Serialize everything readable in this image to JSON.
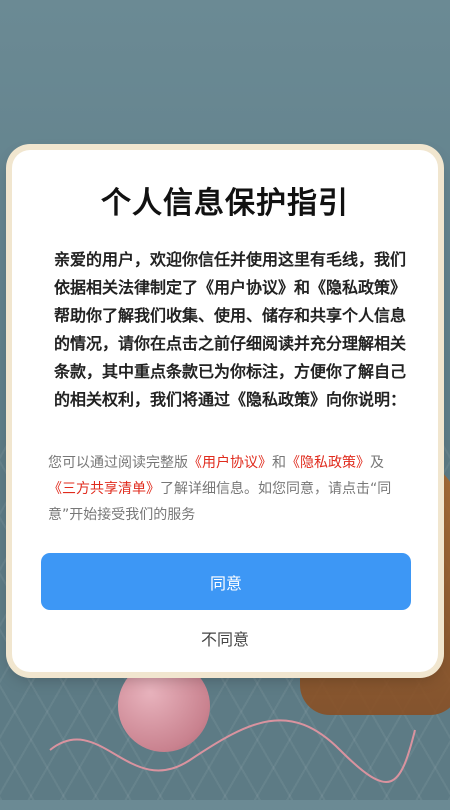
{
  "dialog": {
    "title": "个人信息保护指引",
    "intro": "亲爱的用户，欢迎你信任并使用这里有毛线，我们依据相关法律制定了《用户协议》和《隐私政策》帮助你了解我们收集、使用、储存和共享个人信息的情况，请你在点击之前仔细阅读并充分理解相关条款，其中重点条款已为你标注，方便你了解自己的相关权利，我们将通过《隐私政策》向你说明：",
    "notice": {
      "prefix": "您可以通过阅读完整版",
      "link_user_agreement": "《用户协议》",
      "and": "和",
      "link_privacy_policy": "《隐私政策》",
      "joiner": "及",
      "link_third_party": "《三方共享清单》",
      "suffix": "了解详细信息。如您同意，请点击“同意”开始接受我们的服务"
    },
    "agree_label": "同意",
    "disagree_label": "不同意"
  },
  "colors": {
    "accent_button": "#3d97f5",
    "link": "#e02b1d",
    "dialog_border": "#f1e6cf"
  }
}
